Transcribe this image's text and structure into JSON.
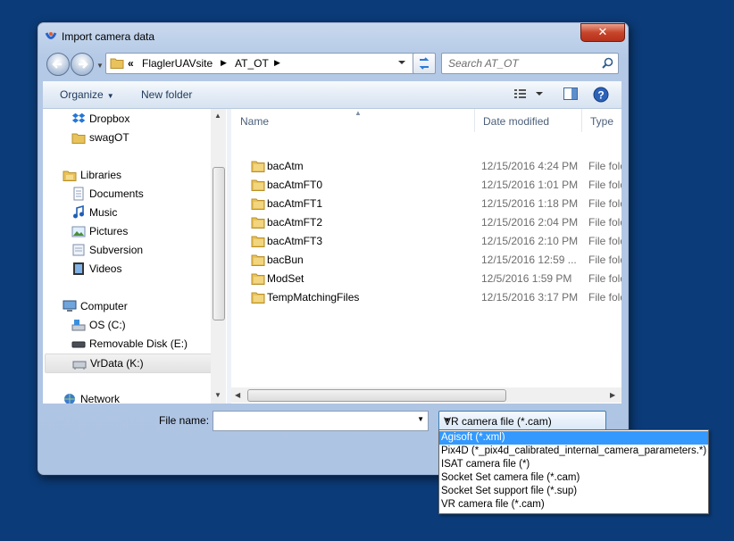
{
  "window": {
    "title": "Import camera data",
    "close_label": "✕"
  },
  "address": {
    "overflow": "«",
    "crumbs": [
      "FlaglerUAVsite",
      "AT_OT"
    ],
    "search_placeholder": "Search AT_OT"
  },
  "toolbar": {
    "organize_label": "Organize",
    "new_folder_label": "New folder"
  },
  "nav": {
    "favorites": [
      "Dropbox",
      "swagOT"
    ],
    "libraries": {
      "label": "Libraries",
      "items": [
        "Documents",
        "Music",
        "Pictures",
        "Subversion",
        "Videos"
      ]
    },
    "computer": {
      "label": "Computer",
      "items": [
        "OS (C:)",
        "Removable Disk (E:)",
        "VrData (K:)"
      ]
    },
    "network": "Network"
  },
  "columns": {
    "name": "Name",
    "date": "Date modified",
    "type": "Type"
  },
  "files": [
    {
      "name": "bacAtm",
      "date": "12/15/2016 4:24 PM",
      "type": "File folder"
    },
    {
      "name": "bacAtmFT0",
      "date": "12/15/2016 1:01 PM",
      "type": "File folder"
    },
    {
      "name": "bacAtmFT1",
      "date": "12/15/2016 1:18 PM",
      "type": "File folder"
    },
    {
      "name": "bacAtmFT2",
      "date": "12/15/2016 2:04 PM",
      "type": "File folder"
    },
    {
      "name": "bacAtmFT3",
      "date": "12/15/2016 2:10 PM",
      "type": "File folder"
    },
    {
      "name": "bacBun",
      "date": "12/15/2016 12:59 ...",
      "type": "File folder"
    },
    {
      "name": "ModSet",
      "date": "12/5/2016 1:59 PM",
      "type": "File folder"
    },
    {
      "name": "TempMatchingFiles",
      "date": "12/15/2016 3:17 PM",
      "type": "File folder"
    }
  ],
  "bottom": {
    "filename_label": "File name:",
    "filename_value": "",
    "filetype_selected": "VR camera file (*.cam)"
  },
  "filetype_options": [
    "Agisoft (*.xml)",
    "Pix4D (*_pix4d_calibrated_internal_camera_parameters.*)",
    "ISAT camera file (*)",
    "Socket Set camera file (*.cam)",
    "Socket Set support file (*.sup)",
    "VR camera file (*.cam)"
  ],
  "colors": {
    "desktop": "#0b3b78",
    "highlight": "#3399ff",
    "folder": "#e8c25a"
  }
}
